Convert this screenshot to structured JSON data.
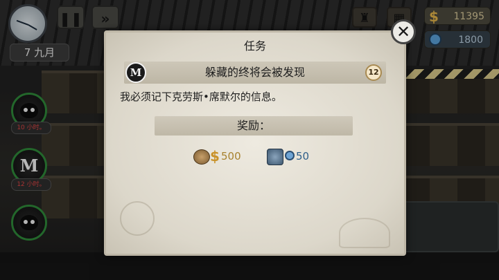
{
  "hud": {
    "date_day": "7",
    "date_month": "九月",
    "money": "11395",
    "coins": "1800",
    "money_symbol": "$"
  },
  "characters": [
    {
      "time_label": "10 小时。"
    },
    {
      "glyph": "M",
      "time_label": "12 小时。"
    },
    {}
  ],
  "modal": {
    "title": "任务",
    "close_label": "✕",
    "quest": {
      "logo_glyph": "M",
      "name": "躲藏的终将会被发现",
      "level": "12"
    },
    "description": "我必须记下克劳斯•席默尔的信息。",
    "reward_label": "奖励：",
    "rewards": {
      "money_symbol": "$",
      "money_value": "500",
      "coins_value": "50"
    }
  },
  "colors": {
    "money_gold": "#c9922a",
    "coins_blue": "#2f5f8a",
    "panel_bg": "#e6e2d6",
    "active_ring": "#2f8a3a"
  }
}
